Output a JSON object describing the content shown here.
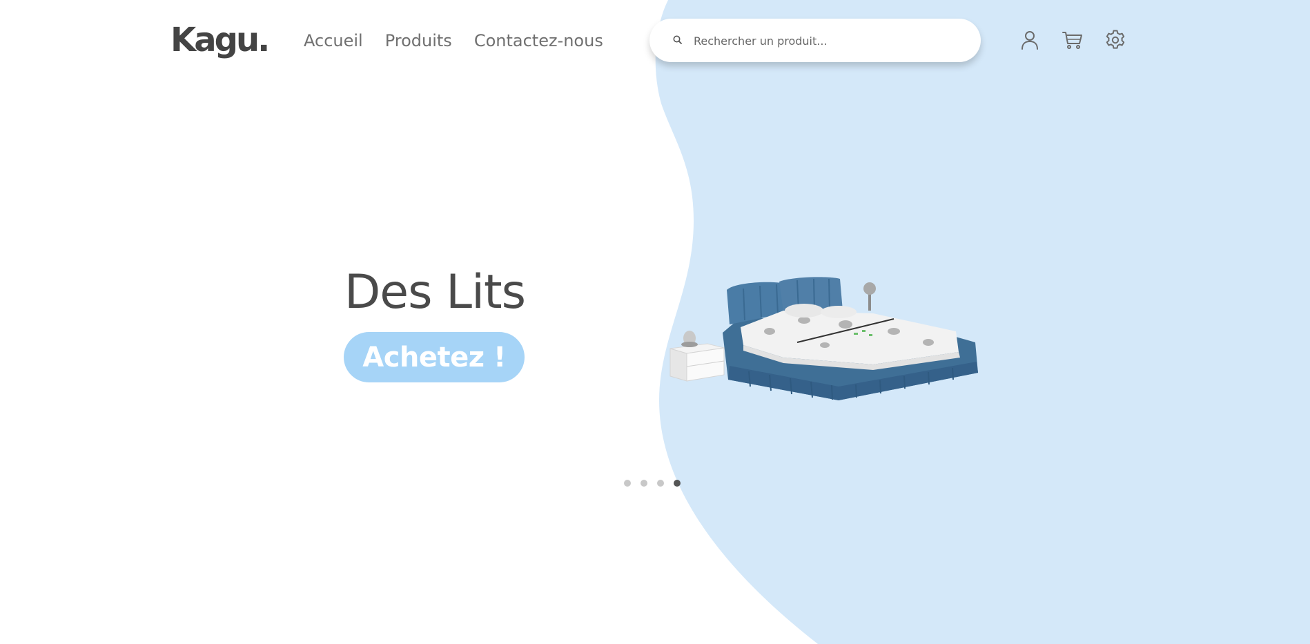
{
  "brand": {
    "logo_text": "Kagu."
  },
  "nav": {
    "items": [
      {
        "label": "Accueil"
      },
      {
        "label": "Produits"
      },
      {
        "label": "Contactez-nous"
      }
    ]
  },
  "search": {
    "placeholder": "Rechercher un produit...",
    "value": ""
  },
  "header_icons": [
    "user-icon",
    "cart-icon",
    "settings-gear-icon"
  ],
  "hero": {
    "title": "Des Lits",
    "cta_label": "Achetez !",
    "image_subject": "blue-upholstered-bed-with-nightstand",
    "slides_total": 4,
    "active_slide": 4
  },
  "colors": {
    "background": "#ffffff",
    "hero_blob": "#d4e8f9",
    "cta": "#a6d4f7",
    "text_dark": "#4a4a4a",
    "nav_text": "#707070",
    "bed_fabric": "#3f6f96"
  }
}
